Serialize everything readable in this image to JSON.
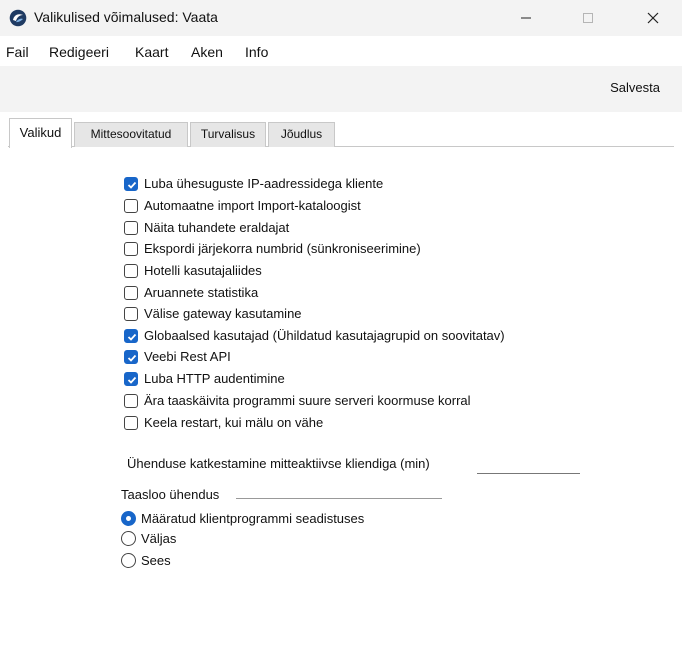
{
  "window": {
    "title": "Valikulised võimalused: Vaata",
    "accent_color": "#1866c9"
  },
  "menu": {
    "items": [
      "Fail",
      "Redigeeri",
      "Kaart",
      "Aken",
      "Info"
    ]
  },
  "toolbar": {
    "save_label": "Salvesta"
  },
  "tabs": [
    {
      "label": "Valikud",
      "active": true
    },
    {
      "label": "Mittesoovitatud",
      "active": false
    },
    {
      "label": "Turvalisus",
      "active": false
    },
    {
      "label": "Jõudlus",
      "active": false
    }
  ],
  "options": [
    {
      "label": "Luba ühesuguste IP-aadressidega kliente",
      "checked": true
    },
    {
      "label": "Automaatne import Import-kataloogist",
      "checked": false
    },
    {
      "label": "Näita tuhandete eraldajat",
      "checked": false
    },
    {
      "label": "Ekspordi järjekorra numbrid (sünkroniseerimine)",
      "checked": false
    },
    {
      "label": "Hotelli kasutajaliides",
      "checked": false
    },
    {
      "label": "Aruannete statistika",
      "checked": false
    },
    {
      "label": "Välise gateway kasutamine",
      "checked": false
    },
    {
      "label": "Globaalsed kasutajad (Ühildatud kasutajagrupid on soovitatav)",
      "checked": true
    },
    {
      "label": "Veebi Rest API",
      "checked": true
    },
    {
      "label": "Luba HTTP audentimine",
      "checked": true
    },
    {
      "label": "Ära taaskäivita programmi suure serveri koormuse korral",
      "checked": false
    },
    {
      "label": "Keela restart, kui mälu on vähe",
      "checked": false
    }
  ],
  "timeout": {
    "label": "Ühenduse katkestamine mitteaktiivse kliendiga (min)",
    "value": ""
  },
  "reconnect": {
    "label": "Taasloo ühendus",
    "options": [
      {
        "label": "Määratud klientprogrammi seadistuses",
        "selected": true
      },
      {
        "label": "Väljas",
        "selected": false
      },
      {
        "label": "Sees",
        "selected": false
      }
    ]
  }
}
